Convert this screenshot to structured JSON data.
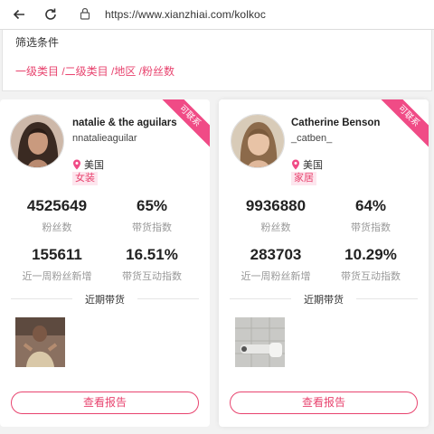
{
  "browser": {
    "url": "https://www.xianzhiai.com/kolkoc"
  },
  "filter": {
    "title": "筛选条件",
    "crumbs": "一级类目 /二级类目 /地区 /粉丝数"
  },
  "colors": {
    "accent": "#e8446f",
    "ribbon": "#f04b86",
    "tag_bg": "#fde6ee"
  },
  "cards": [
    {
      "badge": "可联系",
      "name": "natalie & the aguilars",
      "handle": "nnatalieaguilar",
      "location": "美国",
      "category": "女装",
      "followers": "4525649",
      "followers_label": "粉丝数",
      "sales_index": "65%",
      "sales_index_label": "带货指数",
      "weekly_new": "155611",
      "weekly_new_label": "近一周粉丝新增",
      "interaction": "16.51%",
      "interaction_label": "带货互动指数",
      "recent_label": "近期带货",
      "button": "查看报告"
    },
    {
      "badge": "可联系",
      "name": "Catherine Benson",
      "handle": "_catben_",
      "location": "美国",
      "category": "家居",
      "followers": "9936880",
      "followers_label": "粉丝数",
      "sales_index": "64%",
      "sales_index_label": "带货指数",
      "weekly_new": "283703",
      "weekly_new_label": "近一周粉丝新增",
      "interaction": "10.29%",
      "interaction_label": "带货互动指数",
      "recent_label": "近期带货",
      "button": "查看报告"
    }
  ]
}
